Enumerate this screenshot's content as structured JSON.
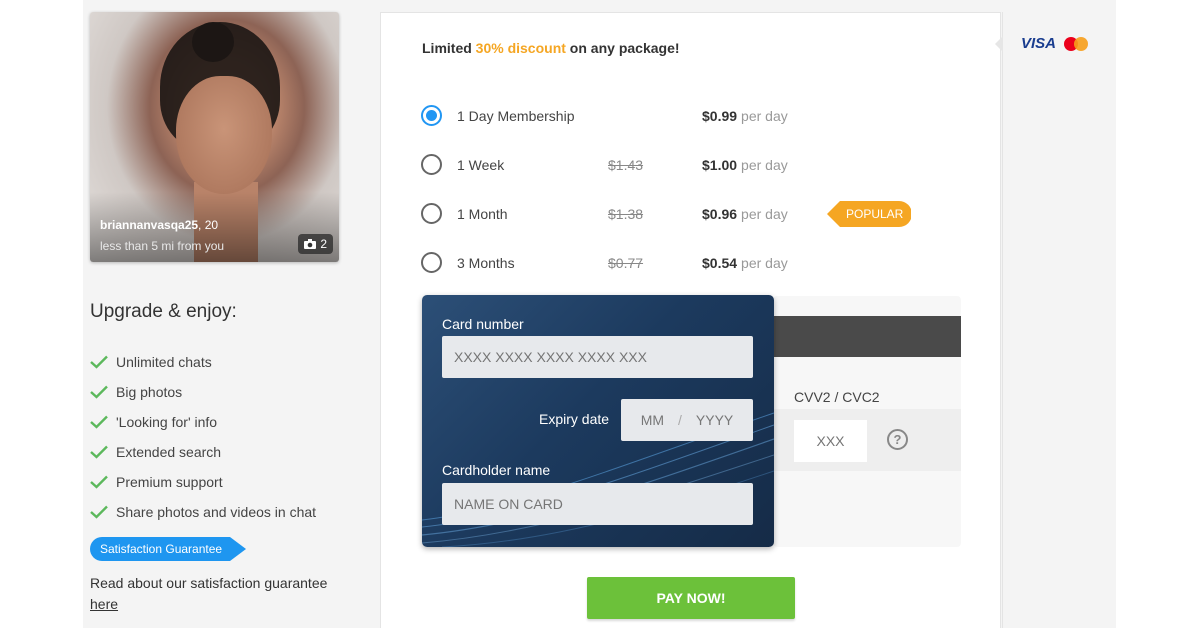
{
  "profile": {
    "username": "briannanvasqa25",
    "age_suffix": ", 20",
    "distance": "less than 5 mi from you",
    "photo_count": "2"
  },
  "upgrade": {
    "title": "Upgrade & enjoy:",
    "benefits": [
      "Unlimited chats",
      "Big photos",
      "'Looking for' info",
      "Extended search",
      "Premium support",
      "Share photos and videos in chat"
    ]
  },
  "guarantee": {
    "badge": "Satisfaction Guarantee",
    "text": "Read about our satisfaction guarantee",
    "link": "here"
  },
  "promo": {
    "prefix": "Limited ",
    "highlight": "30% discount",
    "suffix": " on any package!"
  },
  "plans": [
    {
      "name": "1 Day Membership",
      "old_price": "",
      "price": "$0.99",
      "unit": "per day",
      "selected": true
    },
    {
      "name": "1 Week",
      "old_price": "$1.43",
      "price": "$1.00",
      "unit": "per day",
      "selected": false
    },
    {
      "name": "1 Month",
      "old_price": "$1.38",
      "price": "$0.96",
      "unit": "per day",
      "selected": false,
      "badge": "POPULAR"
    },
    {
      "name": "3 Months",
      "old_price": "$0.77",
      "price": "$0.54",
      "unit": "per day",
      "selected": false
    }
  ],
  "card": {
    "number_label": "Card number",
    "number_placeholder": "XXXX XXXX XXXX XXXX XXX",
    "expiry_label": "Expiry date",
    "month_placeholder": "MM",
    "separator": "/",
    "year_placeholder": "YYYY",
    "holder_label": "Cardholder name",
    "holder_placeholder": "NAME ON CARD",
    "cvv_label": "CVV2 / CVC2",
    "cvv_placeholder": "XXX",
    "help_glyph": "?"
  },
  "pay_button": "PAY NOW!",
  "payment_brands": {
    "visa": "VISA",
    "mastercard_icon": "mastercard-icon"
  },
  "colors": {
    "accent_blue": "#2196f3",
    "discount_orange": "#f5a623",
    "pay_green": "#6cc13a",
    "card_navy": "#1c3a5e"
  }
}
